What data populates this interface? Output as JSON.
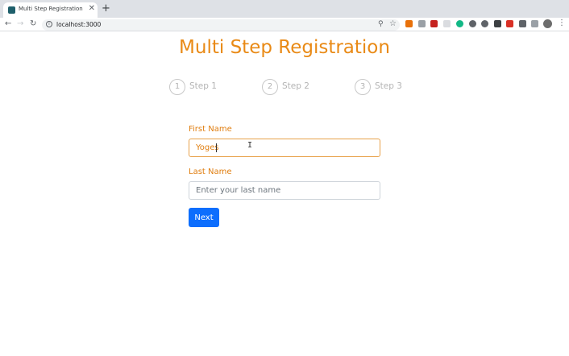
{
  "browser": {
    "tab_title": "Multi Step Registration",
    "tab_close": "✕",
    "new_tab": "+",
    "url": "localhost:3000",
    "nav_back": "←",
    "nav_forward": "→",
    "nav_reload": "↻",
    "info": "i",
    "zoom": "⚲",
    "star": "☆",
    "menu": "⋮",
    "extensions": [
      {
        "name": "ext-orange-icon",
        "color": "#e8710a"
      },
      {
        "name": "ext-gray-icon",
        "color": "#9aa0a6"
      },
      {
        "name": "ext-red-icon",
        "color": "#c5221f"
      },
      {
        "name": "ext-light-icon",
        "color": "#dadce0"
      },
      {
        "name": "ext-green-icon",
        "color": "#12b886"
      },
      {
        "name": "ext-circle-icon",
        "color": "#5f6368"
      },
      {
        "name": "ext-check-icon",
        "color": "#5f6368"
      },
      {
        "name": "ext-dark-icon",
        "color": "#3c4043"
      },
      {
        "name": "ext-redgray-icon",
        "color": "#d93025"
      },
      {
        "name": "puzzle-icon",
        "color": "#5f6368"
      },
      {
        "name": "ext-list-icon",
        "color": "#9aa0a6"
      }
    ]
  },
  "page": {
    "title": "Multi Step Registration",
    "steps": [
      {
        "number": "1",
        "label": "Step 1"
      },
      {
        "number": "2",
        "label": "Step 2"
      },
      {
        "number": "3",
        "label": "Step 3"
      }
    ],
    "form": {
      "first_name_label": "First Name",
      "first_name_value": "Yoges",
      "last_name_label": "Last Name",
      "last_name_placeholder": "Enter your last name",
      "next_label": "Next"
    }
  },
  "colors": {
    "accent": "#e98a16",
    "primary": "#0d6efd",
    "muted": "#b4b4b4"
  }
}
